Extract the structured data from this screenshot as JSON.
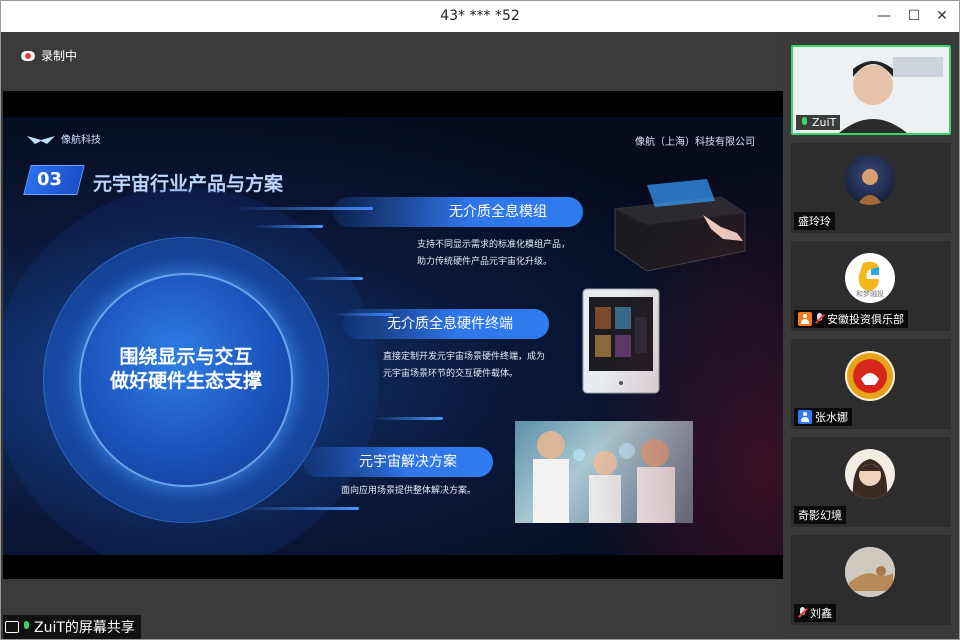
{
  "window": {
    "title": "43* *** *52"
  },
  "recording": {
    "label": "录制中"
  },
  "slide": {
    "company": "像航（上海）科技有限公司",
    "logo_text": "像航科技",
    "section_number": "03",
    "section_title": "元宇宙行业产品与方案",
    "center_line1": "围绕显示与交互",
    "center_line2": "做好硬件生态支撑",
    "items": [
      {
        "title": "无介质全息模组",
        "desc1": "支持不同显示需求的标准化模组产品，",
        "desc2": "助力传统硬件产品元宇宙化升级。"
      },
      {
        "title": "无介质全息硬件终端",
        "desc1": "直接定制开发元宇宙场景硬件终端，成为",
        "desc2": "元宇宙场景环节的交互硬件载体。"
      },
      {
        "title": "元宇宙解决方案",
        "desc1": "面向应用场景提供整体解决方案。",
        "desc2": ""
      }
    ]
  },
  "participants": [
    {
      "name": "ZuiT",
      "kind": "video",
      "mic": "on"
    },
    {
      "name": "盛玲玲",
      "kind": "avatar",
      "mic": "none"
    },
    {
      "name": "安徽投资俱乐部",
      "kind": "avatar",
      "mic": "off",
      "badge": "orange",
      "avatar_text": "和梦融投"
    },
    {
      "name": "张水娜",
      "kind": "avatar",
      "mic": "none",
      "badge": "blue"
    },
    {
      "name": "奇影幻境",
      "kind": "avatar",
      "mic": "none"
    },
    {
      "name": "刘鑫",
      "kind": "avatar",
      "mic": "off"
    }
  ],
  "share_status": {
    "label": "ZuiT的屏幕共享"
  },
  "colors": {
    "accent_green": "#3bd36b",
    "slide_blue": "#2f76ea",
    "mute_red": "#e53935"
  }
}
